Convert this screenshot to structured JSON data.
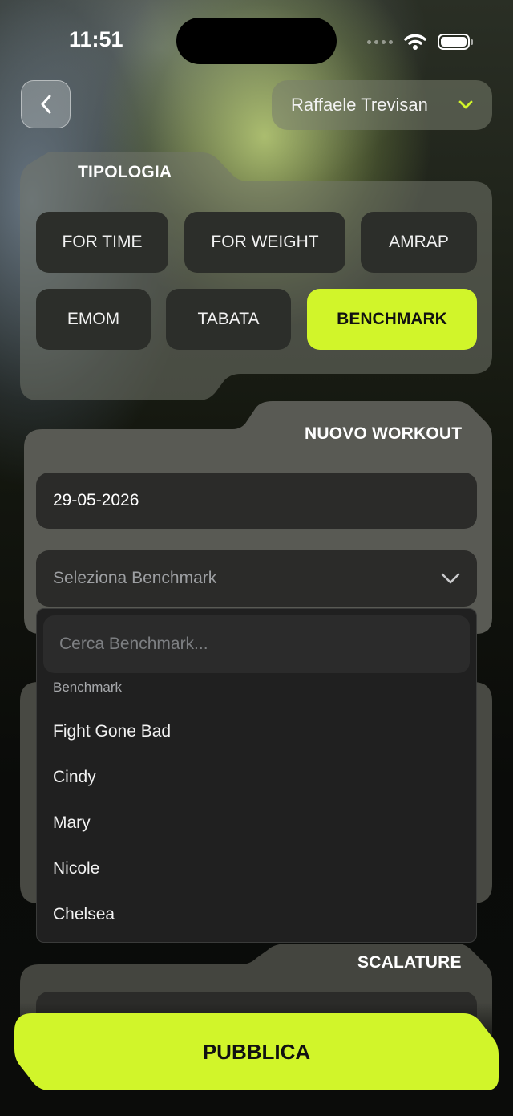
{
  "status_bar": {
    "time": "11:51"
  },
  "header": {
    "back_icon": "chevron-left-icon",
    "user_name": "Raffaele Trevisan",
    "dropdown_icon": "chevron-down-icon"
  },
  "tipologia": {
    "title": "TIPOLOGIA",
    "options": [
      "FOR TIME",
      "FOR WEIGHT",
      "AMRAP",
      "EMOM",
      "TABATA",
      "BENCHMARK"
    ],
    "selected": "BENCHMARK"
  },
  "nuovo_workout": {
    "title": "NUOVO WORKOUT",
    "date_value": "29-05-2026",
    "benchmark_placeholder": "Seleziona Benchmark"
  },
  "benchmark_dropdown": {
    "search_placeholder": "Cerca Benchmark...",
    "group_label": "Benchmark",
    "options": [
      "Fight Gone Bad",
      "Cindy",
      "Mary",
      "Nicole",
      "Chelsea"
    ]
  },
  "scalature": {
    "title": "SCALATURE"
  },
  "publish_label": "PUBBLICA",
  "colors": {
    "accent": "#d1f52a",
    "panel": "#5a5b55",
    "field": "#2b2b29"
  }
}
